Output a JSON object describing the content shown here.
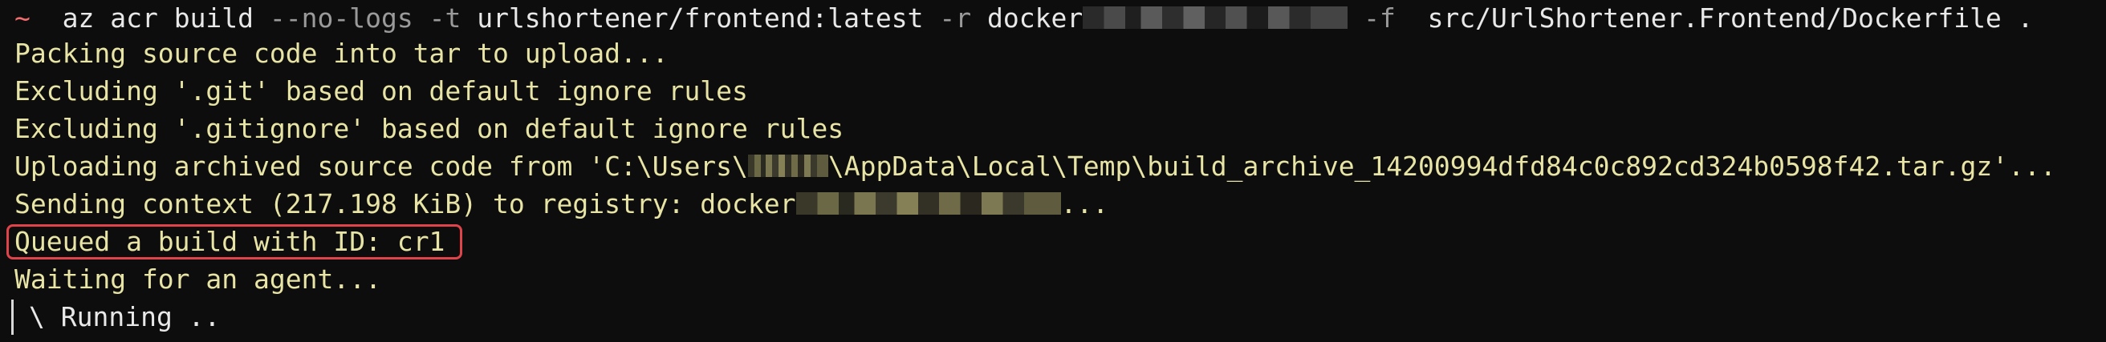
{
  "terminal": {
    "command": {
      "prompt": "~",
      "parts": [
        {
          "type": "cmd",
          "text": "az acr build "
        },
        {
          "type": "flag",
          "text": "--no-logs "
        },
        {
          "type": "flag",
          "text": "-t "
        },
        {
          "type": "arg",
          "text": "urlshortener/frontend:latest "
        },
        {
          "type": "flag",
          "text": "-r "
        },
        {
          "type": "arg",
          "text": "docker"
        },
        {
          "type": "flag",
          "text": " -f "
        },
        {
          "type": "arg",
          "text": "src/UrlShortener.Frontend/Dockerfile ."
        }
      ]
    },
    "output": [
      "Packing source code into tar to upload...",
      "Excluding '.git' based on default ignore rules",
      "Excluding '.gitignore' based on default ignore rules",
      {
        "pre": "Uploading archived source code from 'C:\\Users\\",
        "post": "\\AppData\\Local\\Temp\\build_archive_14200994dfd84c0c892cd324b0598f42.tar.gz'..."
      },
      {
        "pre": "Sending context (217.198 KiB) to registry: docker",
        "post": "..."
      },
      "Queued a build with ID: cr1",
      "Waiting for an agent..."
    ],
    "spinner": "\\ Running ..",
    "colors": {
      "background": "#0d0d0d",
      "output_text": "#e7e4a6",
      "prompt": "#f26d6d",
      "flag": "#9a9a9a",
      "highlight": "#e0444b"
    }
  }
}
